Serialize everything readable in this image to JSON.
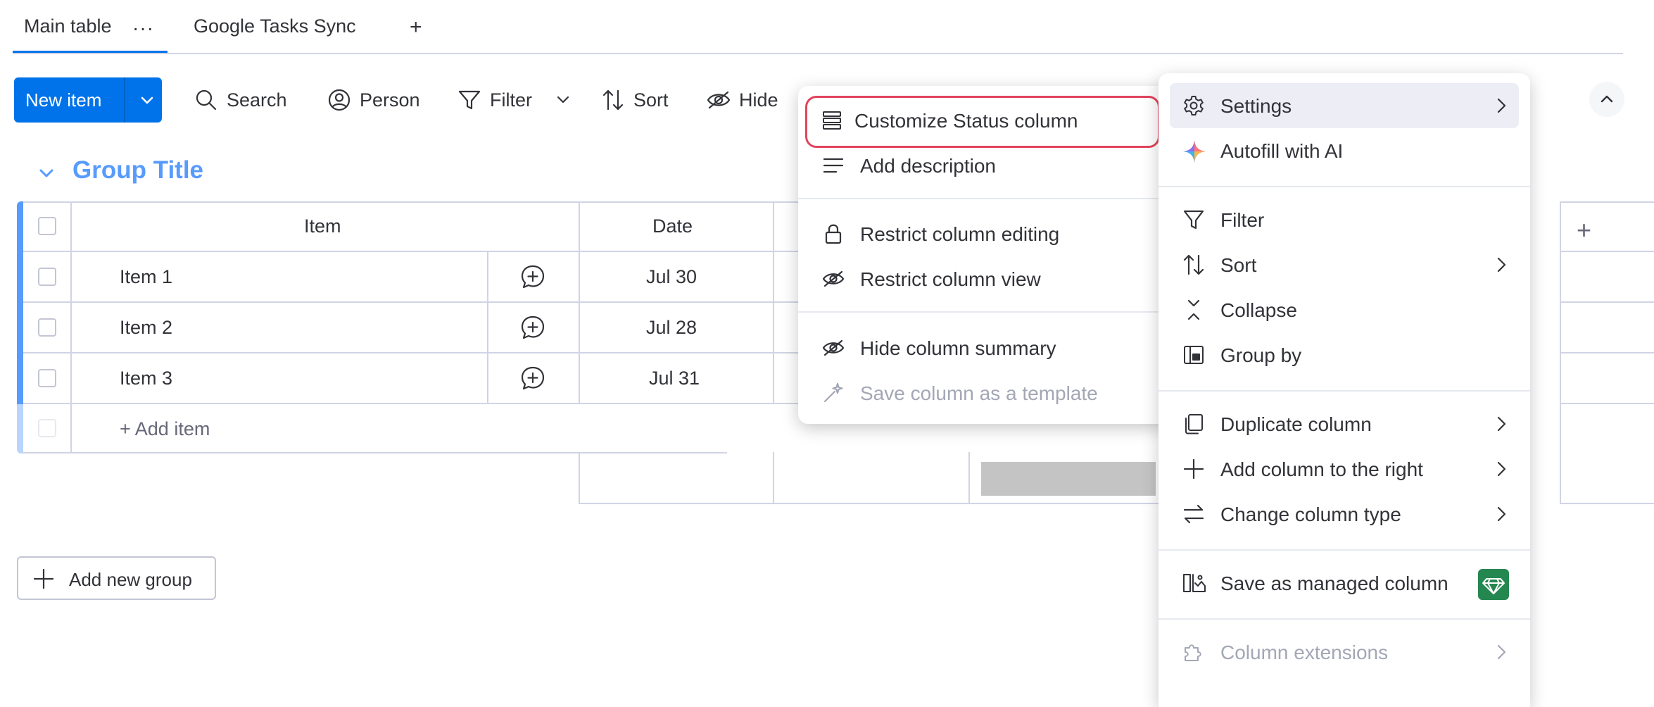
{
  "tabs": {
    "main_label": "Main table",
    "more": "···",
    "sync_label": "Google Tasks Sync",
    "add": "+"
  },
  "toolbar": {
    "new_item": "New item",
    "search": "Search",
    "person": "Person",
    "filter": "Filter",
    "sort": "Sort",
    "hide": "Hide"
  },
  "group": {
    "title": "Group Title",
    "columns": [
      "Item",
      "Date"
    ],
    "rows": [
      {
        "item": "Item 1",
        "date": "Jul 30"
      },
      {
        "item": "Item 2",
        "date": "Jul 28"
      },
      {
        "item": "Item 3",
        "date": "Jul 31"
      }
    ],
    "add_item": "+ Add item",
    "add_column": "+"
  },
  "add_group": "Add new group",
  "column_menu": {
    "items": [
      {
        "label": "Customize Status column",
        "icon": "list-lines-icon",
        "highlighted": true
      },
      {
        "label": "Add description",
        "icon": "text-lines-icon"
      },
      {
        "label": "Restrict column editing",
        "icon": "lock-icon"
      },
      {
        "label": "Restrict column view",
        "icon": "eye-slash-icon"
      },
      {
        "label": "Hide column summary",
        "icon": "eye-slash-icon"
      },
      {
        "label": "Save column as a template",
        "icon": "magic-wand-icon",
        "disabled": true
      }
    ]
  },
  "settings_menu": {
    "items": [
      {
        "label": "Settings",
        "icon": "gear-icon",
        "has_submenu": true,
        "active": true
      },
      {
        "label": "Autofill with AI",
        "icon": "ai-sparkle-icon"
      },
      {
        "label": "Filter",
        "icon": "filter-icon"
      },
      {
        "label": "Sort",
        "icon": "sort-icon",
        "has_submenu": true
      },
      {
        "label": "Collapse",
        "icon": "collapse-icon"
      },
      {
        "label": "Group by",
        "icon": "group-by-icon"
      },
      {
        "label": "Duplicate column",
        "icon": "duplicate-icon",
        "has_submenu": true
      },
      {
        "label": "Add column to the right",
        "icon": "plus-icon",
        "has_submenu": true
      },
      {
        "label": "Change column type",
        "icon": "swap-icon",
        "has_submenu": true
      },
      {
        "label": "Save as managed column",
        "icon": "managed-column-icon",
        "badge": "premium-gem-icon"
      },
      {
        "label": "Column extensions",
        "icon": "puzzle-icon",
        "has_submenu": true,
        "disabled": true
      }
    ]
  },
  "colors": {
    "primary": "#0073ea",
    "group": "#579bfc",
    "highlight": "#e2445c",
    "premium": "#258750"
  }
}
